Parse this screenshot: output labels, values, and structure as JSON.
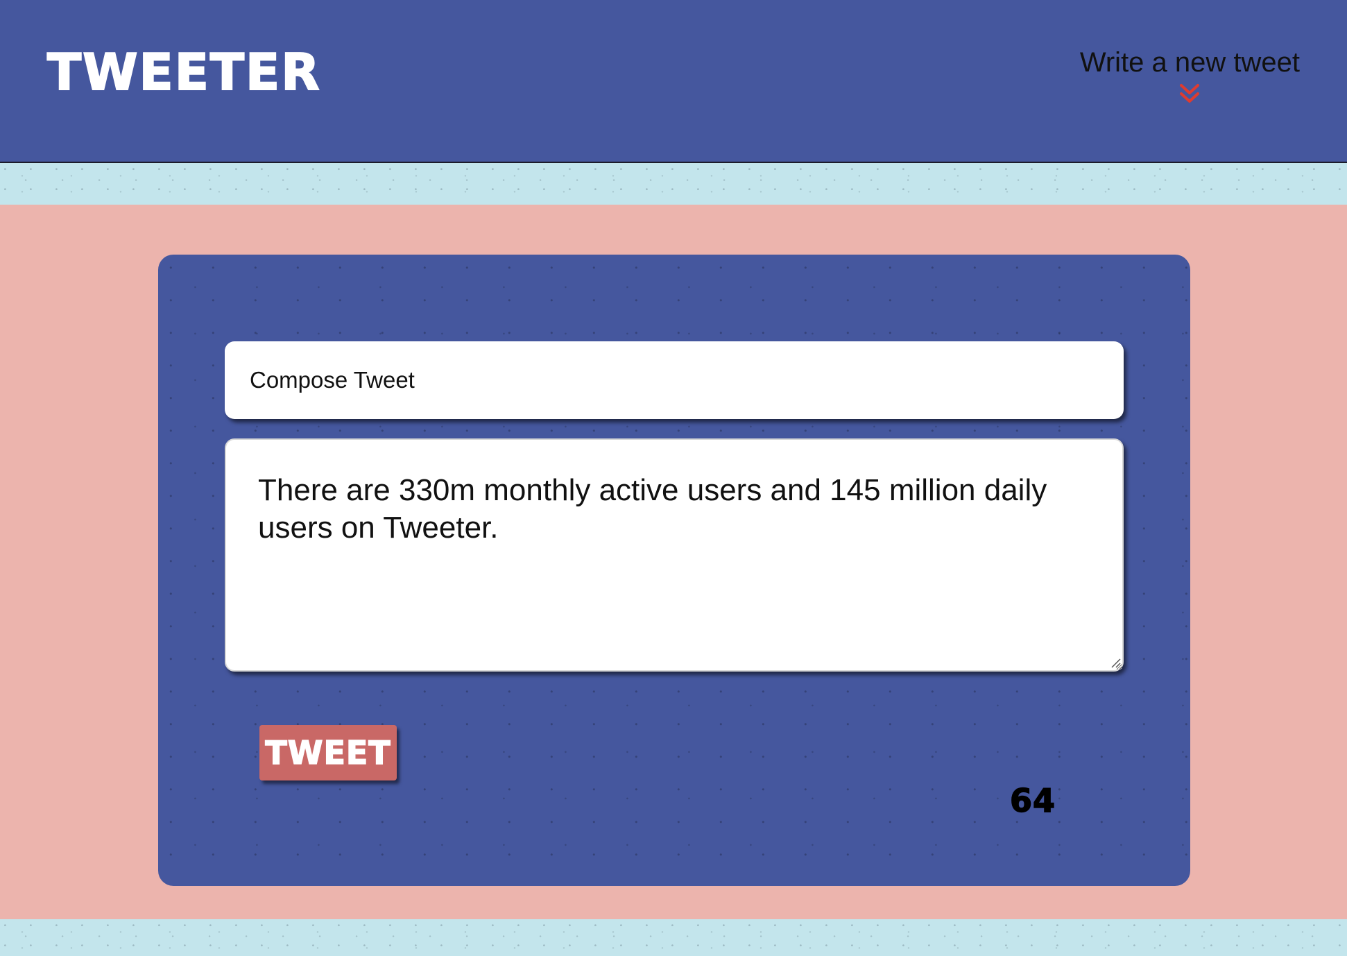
{
  "header": {
    "logo": "TWEETER",
    "write_new_label": "Write a new tweet",
    "toggle_icon": "double-chevron-down-icon",
    "accent_color": "#e03b2f"
  },
  "composer": {
    "label": "Compose Tweet",
    "textarea_value": "There are 330m monthly active users and 145 million daily users on Tweeter.",
    "submit_label": "TWEET",
    "char_counter": "64"
  },
  "colors": {
    "header_bg": "#45579e",
    "panel_bg": "#45579e",
    "main_bg": "#ecb4ad",
    "strip_bg": "#c3e5ec",
    "button_bg": "#c96866"
  }
}
